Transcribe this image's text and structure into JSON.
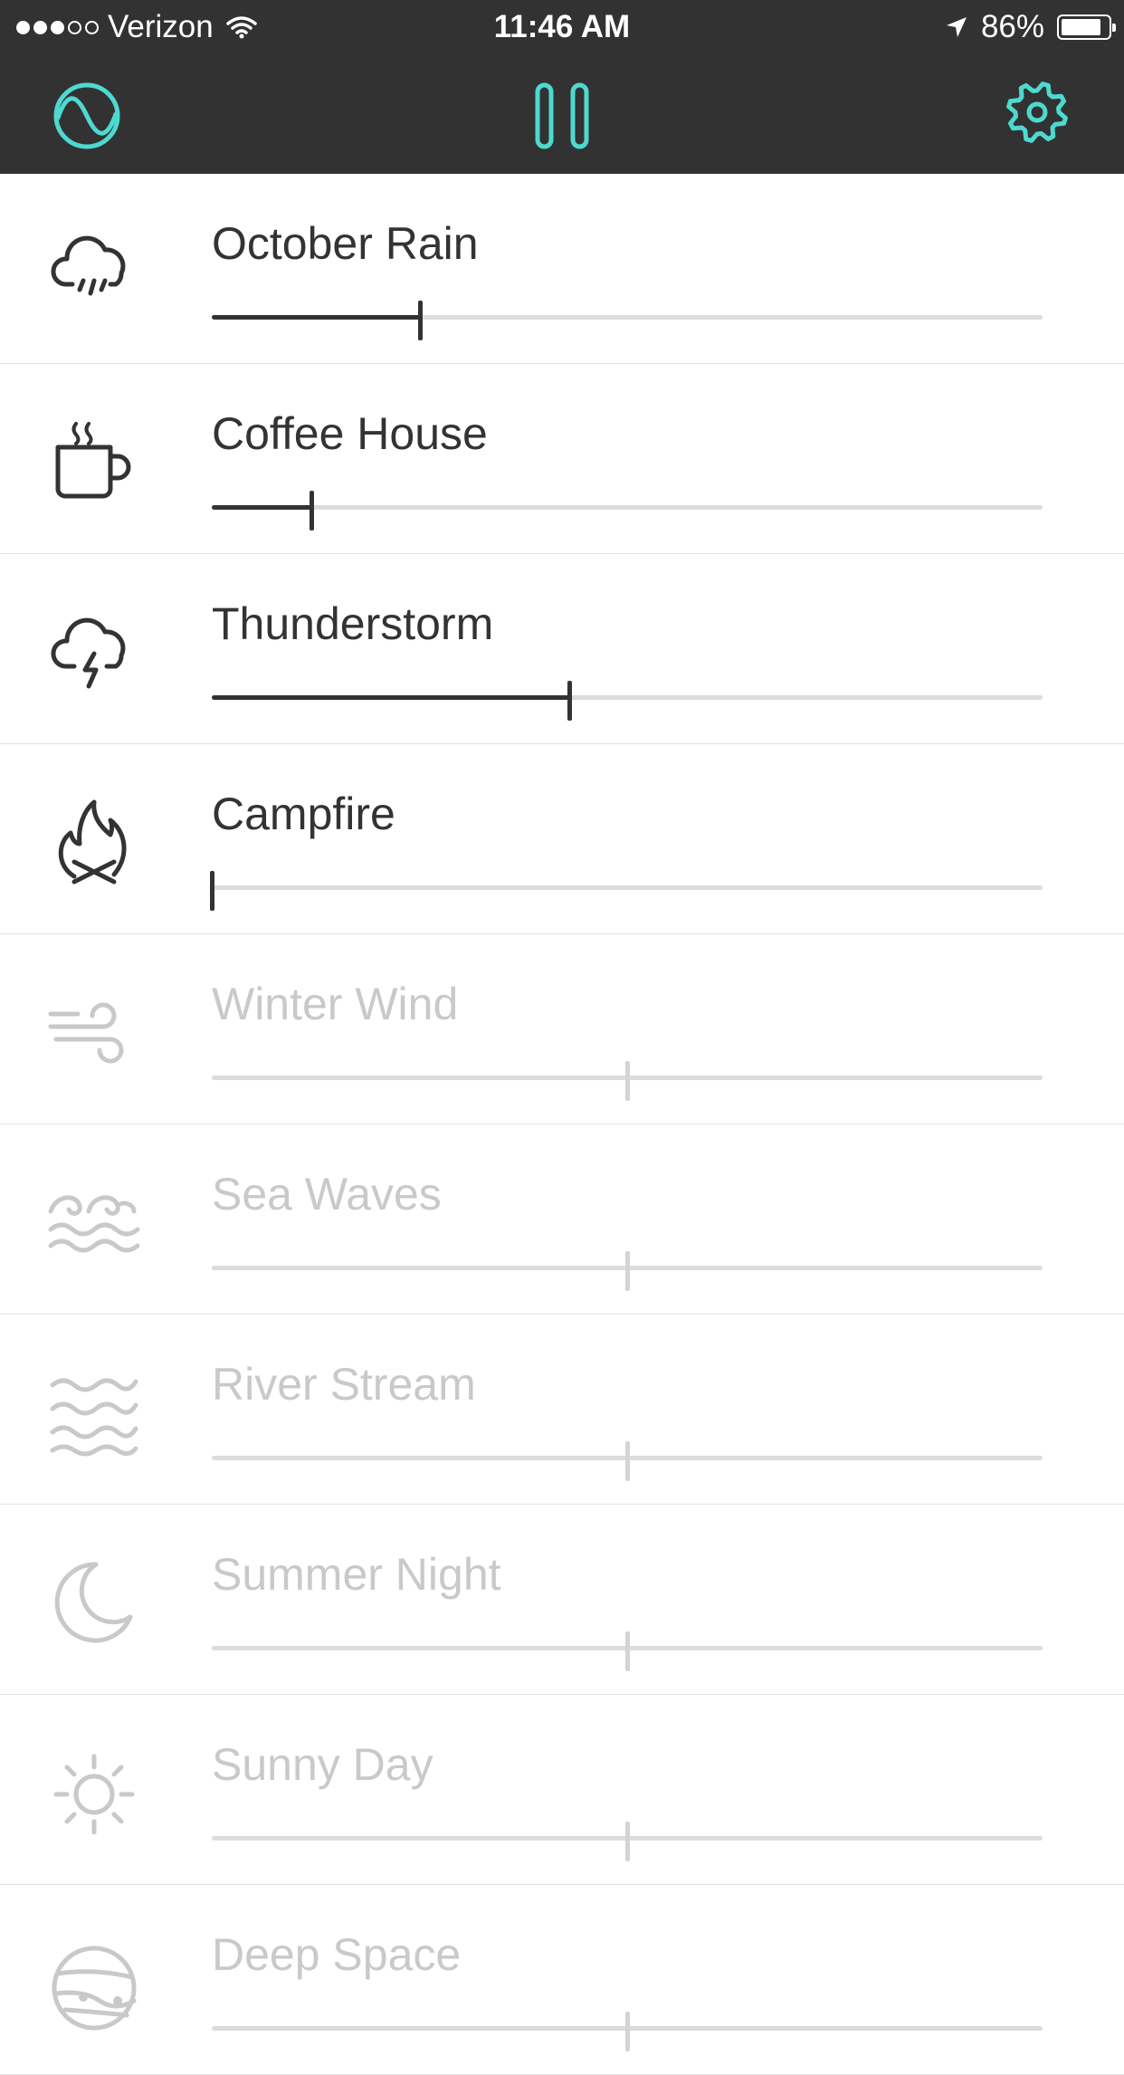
{
  "status_bar": {
    "signal_bars_filled": 3,
    "signal_bars_total": 5,
    "carrier": "Verizon",
    "time": "11:46 AM",
    "battery_text": "86%",
    "battery_level": 0.86,
    "icons": [
      "wifi-icon",
      "location-arrow-icon",
      "battery-icon"
    ]
  },
  "header": {
    "left_icon": "wave-circle-icon",
    "center_icon": "pause-icon",
    "right_icon": "gear-icon",
    "accent_color": "#4ED9D0",
    "bar_color": "#323232"
  },
  "sounds": [
    {
      "label": "October Rain",
      "icon": "rain-cloud-icon",
      "active": true,
      "level": 0.25
    },
    {
      "label": "Coffee House",
      "icon": "coffee-cup-icon",
      "active": true,
      "level": 0.12
    },
    {
      "label": "Thunderstorm",
      "icon": "thunder-cloud-icon",
      "active": true,
      "level": 0.43
    },
    {
      "label": "Campfire",
      "icon": "campfire-icon",
      "active": true,
      "level": 0.0
    },
    {
      "label": "Winter Wind",
      "icon": "wind-icon",
      "active": false,
      "level": 0.5
    },
    {
      "label": "Sea Waves",
      "icon": "sea-waves-icon",
      "active": false,
      "level": 0.5
    },
    {
      "label": "River Stream",
      "icon": "river-stream-icon",
      "active": false,
      "level": 0.5
    },
    {
      "label": "Summer Night",
      "icon": "moon-icon",
      "active": false,
      "level": 0.5
    },
    {
      "label": "Sunny Day",
      "icon": "sun-icon",
      "active": false,
      "level": 0.5
    },
    {
      "label": "Deep Space",
      "icon": "planet-icon",
      "active": false,
      "level": 0.5
    }
  ],
  "colors": {
    "active_text": "#333333",
    "inactive_text": "#C9C9C9",
    "track": "#DCDCDC"
  }
}
